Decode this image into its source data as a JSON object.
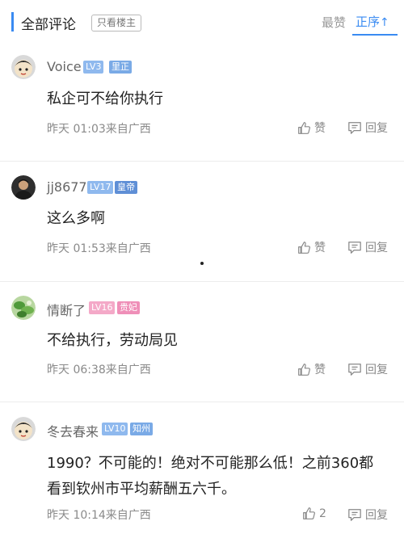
{
  "header": {
    "title": "全部评论",
    "only_host": "只看楼主",
    "sort_hot": "最赞",
    "sort_asc": "正序",
    "sort_asc_icon": "↑"
  },
  "comments": [
    {
      "username": "Voice",
      "level": "LV3",
      "title": "里正",
      "content": "私企可不给你执行",
      "meta": "昨天 01:03来自广西",
      "like_label": "赞",
      "reply_label": "回复",
      "level_color": "#8fb9ee",
      "title_color": "#7aaae6",
      "avatar": "avatar-cartoon-icon"
    },
    {
      "username": "jj8677",
      "level": "LV17",
      "title": "皇帝",
      "content": "这么多啊",
      "meta": "昨天 01:53来自广西",
      "like_label": "赞",
      "reply_label": "回复",
      "level_color": "#8fb9ee",
      "title_color": "#5f8fd6",
      "avatar": "avatar-photo-icon"
    },
    {
      "username": "情断了",
      "level": "LV16",
      "title": "贵妃",
      "content": "不给执行，劳动局见",
      "meta": "昨天 06:38来自广西",
      "like_label": "赞",
      "reply_label": "回复",
      "level_color": "#f4a9c8",
      "title_color": "#ef8fb8",
      "avatar": "avatar-plant-icon"
    },
    {
      "username": "冬去春来",
      "level": "LV10",
      "title": "知州",
      "content": "1990？不可能的！绝对不可能那么低！之前360都看到钦州市平均薪酬五六千。",
      "meta": "昨天 10:14来自广西",
      "like_label": "2",
      "reply_label": "回复",
      "level_color": "#8fb9ee",
      "title_color": "#7aaae6",
      "avatar": "avatar-cartoon-icon"
    }
  ]
}
